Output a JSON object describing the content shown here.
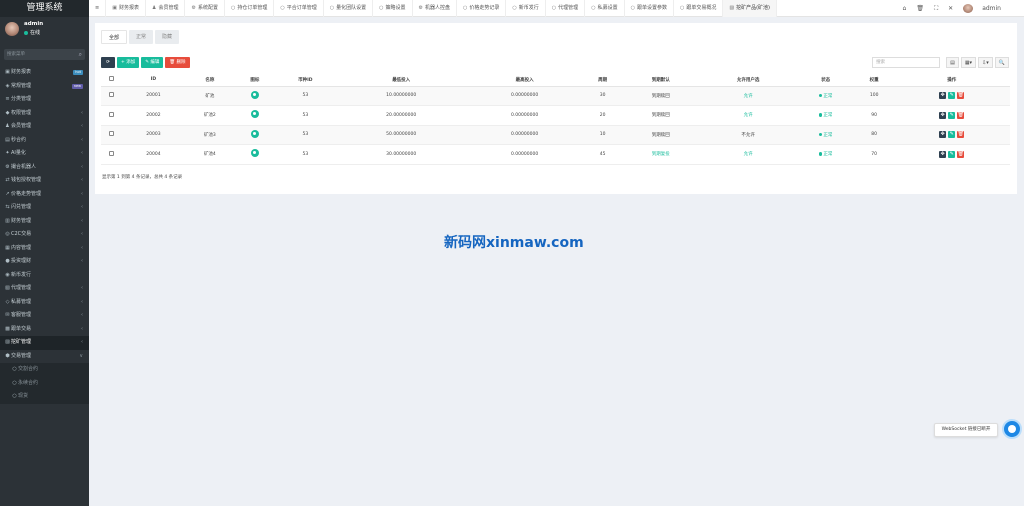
{
  "sidebar": {
    "title": "管理系统",
    "user": "admin",
    "status": "在线",
    "search_placeholder": "搜索菜单",
    "items": [
      {
        "label": "财务报表",
        "icon": "▣",
        "badge": "hot",
        "badge_color": "#3c8dbc"
      },
      {
        "label": "常规管理",
        "icon": "◈",
        "badge": "new",
        "badge_color": "#605ca8"
      },
      {
        "label": "分类管理",
        "icon": "≡"
      },
      {
        "label": "权限管理",
        "icon": "◆",
        "chevron": "‹"
      },
      {
        "label": "会员管理",
        "icon": "♟",
        "chevron": "‹"
      },
      {
        "label": "秒合约",
        "icon": "▤",
        "chevron": "‹"
      },
      {
        "label": "AI量化",
        "icon": "✦",
        "chevron": "‹"
      },
      {
        "label": "撮合机器人",
        "icon": "⚙",
        "chevron": "‹"
      },
      {
        "label": "钱包授权管理",
        "icon": "⇄",
        "chevron": "‹"
      },
      {
        "label": "价格走势管理",
        "icon": "↗",
        "chevron": "‹"
      },
      {
        "label": "闪兑管理",
        "icon": "⇆",
        "chevron": "‹"
      },
      {
        "label": "财务管理",
        "icon": "▥",
        "chevron": "‹"
      },
      {
        "label": "C2C交易",
        "icon": "◎",
        "chevron": "‹"
      },
      {
        "label": "内容管理",
        "icon": "▦",
        "chevron": "‹"
      },
      {
        "label": "投资理财",
        "icon": "●",
        "chevron": "‹"
      },
      {
        "label": "新币发行",
        "icon": "◉"
      },
      {
        "label": "代理管理",
        "icon": "▧",
        "chevron": "‹"
      },
      {
        "label": "私募管理",
        "icon": "◇",
        "chevron": "‹"
      },
      {
        "label": "客服管理",
        "icon": "✉",
        "chevron": "‹"
      },
      {
        "label": "跟单交易",
        "icon": "▩",
        "chevron": "‹"
      },
      {
        "label": "挖矿管理",
        "icon": "▨",
        "chevron": "‹",
        "active": true
      },
      {
        "label": "交易管理",
        "icon": "⬢",
        "chevron": "∨"
      }
    ],
    "sub_items": [
      "交割合约",
      "永续合约",
      "现货"
    ]
  },
  "topbar": {
    "tabs": [
      {
        "label": "≡",
        "icon": ""
      },
      {
        "label": "财务报表",
        "icon": "▣"
      },
      {
        "label": "会员管理",
        "icon": "♟"
      },
      {
        "label": "系统配置",
        "icon": "⚙"
      },
      {
        "label": "持仓订单管理",
        "icon": "○"
      },
      {
        "label": "平合订单管理",
        "icon": "○"
      },
      {
        "label": "量化团队设置",
        "icon": "○"
      },
      {
        "label": "策略设置",
        "icon": "○"
      },
      {
        "label": "机器人控盘",
        "icon": "⚙"
      },
      {
        "label": "价格走势记录",
        "icon": "○"
      },
      {
        "label": "新币发行",
        "icon": "○"
      },
      {
        "label": "代理管理",
        "icon": "○"
      },
      {
        "label": "私募设置",
        "icon": "○"
      },
      {
        "label": "跟单设置参数",
        "icon": "○"
      },
      {
        "label": "跟单交易概况",
        "icon": "○"
      },
      {
        "label": "挖矿产品(矿池)",
        "icon": "▨",
        "current": true
      }
    ],
    "right_icons": [
      "⌂",
      "🗑",
      "⛶",
      "✕"
    ],
    "user": "admin"
  },
  "content": {
    "subtabs": [
      "全部",
      "正常",
      "隐藏"
    ],
    "toolbar": {
      "refresh": "⟳",
      "add": "+ 添加",
      "edit": "✎ 编辑",
      "delete": "🗑 删除"
    },
    "search_placeholder": "搜索",
    "tools": [
      "▤",
      "▦▾",
      "⇩▾",
      "🔍"
    ],
    "columns": [
      "ID",
      "名称",
      "图标",
      "币种ID",
      "最低投入",
      "最高投入",
      "周期",
      "到期默认",
      "允许用户选",
      "状态",
      "权重",
      "操作"
    ],
    "rows": [
      {
        "id": "20001",
        "name": "矿池",
        "coin": "53",
        "min": "10.00000000",
        "max": "0.00000000",
        "period": "30",
        "expire": "到期赎回",
        "allow": "允许",
        "status": "正常",
        "weight": "100"
      },
      {
        "id": "20002",
        "name": "矿池2",
        "coin": "53",
        "min": "20.00000000",
        "max": "0.00000000",
        "period": "20",
        "expire": "到期赎回",
        "allow": "允许",
        "status": "正常",
        "weight": "90"
      },
      {
        "id": "20003",
        "name": "矿池3",
        "coin": "53",
        "min": "50.00000000",
        "max": "0.00000000",
        "period": "10",
        "expire": "到期赎回",
        "allow": "不允许",
        "status": "正常",
        "weight": "80"
      },
      {
        "id": "20004",
        "name": "矿池4",
        "coin": "53",
        "min": "30.00000000",
        "max": "0.00000000",
        "period": "45",
        "expire": "到期复投",
        "allow": "允许",
        "status": "正常",
        "weight": "70"
      }
    ],
    "footer": "显示第 1 到第 4 条记录，总共 4 条记录"
  },
  "watermark": "新码网xinmaw.com",
  "ws_notice": "WebSocket 链接已断开",
  "colors": {
    "accent": "#18bc9c",
    "danger": "#e74c3c",
    "dark": "#2f4050",
    "sidebar": "#2c3237"
  }
}
